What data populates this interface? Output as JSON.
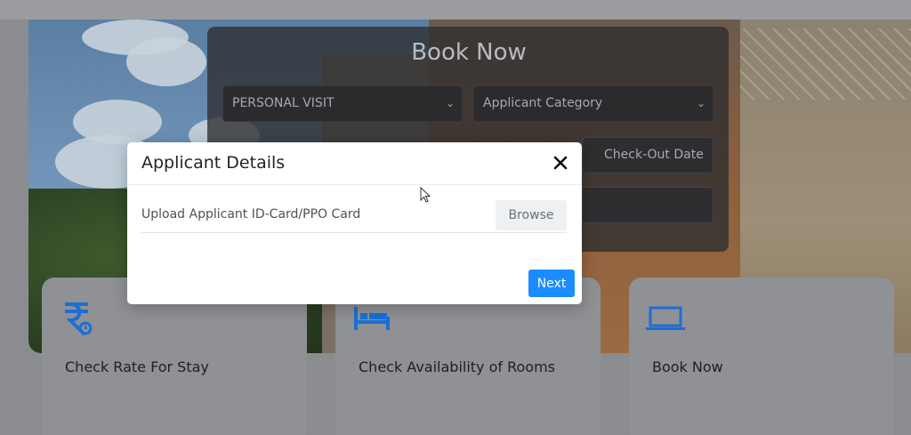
{
  "background": {
    "booking_panel": {
      "title": "Book Now",
      "visit_type": "PERSONAL VISIT",
      "applicant_category": "Applicant Category",
      "checkout_date": "Check-Out Date"
    },
    "cards": [
      {
        "label": "Check Rate For Stay",
        "icon": "rupee-icon"
      },
      {
        "label": "Check Availability of Rooms",
        "icon": "bed-icon"
      },
      {
        "label": "Book Now",
        "icon": "laptop-icon"
      }
    ]
  },
  "modal": {
    "title": "Applicant Details",
    "upload_label": "Upload Applicant ID-Card/PPO Card",
    "browse_label": "Browse",
    "next_label": "Next",
    "close_icon": "close-icon"
  },
  "colors": {
    "primary_button": "#1a8cff",
    "card_icon": "#1a6fd6"
  }
}
